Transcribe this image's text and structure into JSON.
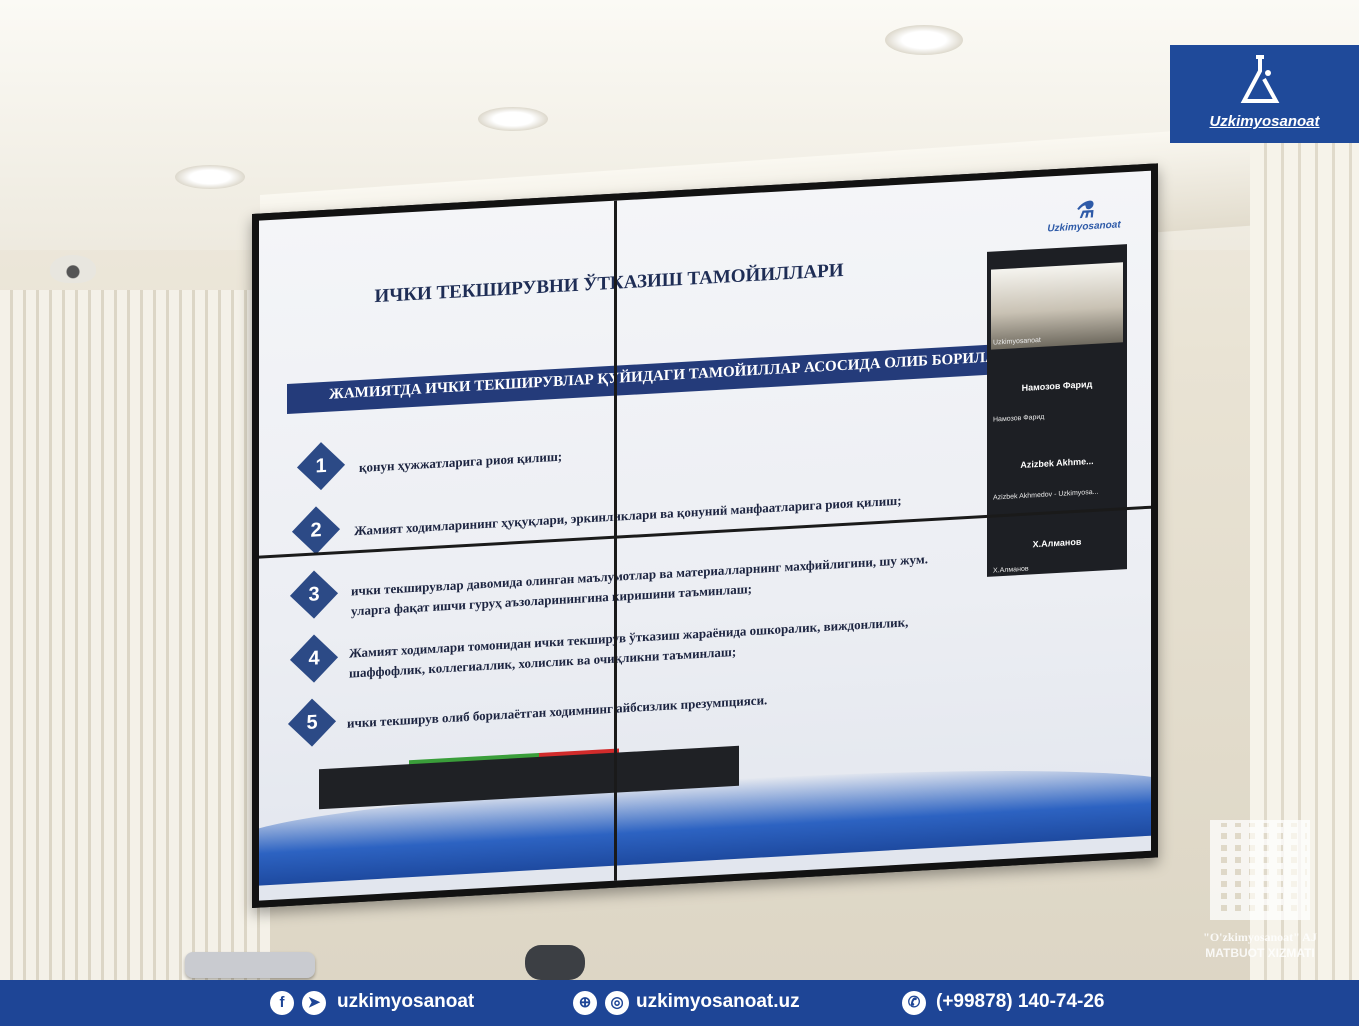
{
  "brand": {
    "name": "Uzkimyosanoat"
  },
  "tv_logo": "Uzkimyosanoat",
  "press_service": {
    "line1": "\"O'zkimyosanoat\" AJ",
    "line2": "MATBUOT XIZMATI"
  },
  "slide": {
    "title": "ИЧКИ ТЕКШИРУВНИ ЎТКАЗИШ ТАМОЙИЛЛАРИ",
    "band": "ЖАМИЯТДА ИЧКИ ТЕКШИРУВЛАР ҚУЙИДАГИ ТАМОЙИЛЛАР АСОСИДА ОЛИБ БОРИЛАД",
    "items": [
      {
        "num": "1",
        "text": "қонун ҳужжатларига риоя қилиш;"
      },
      {
        "num": "2",
        "text": "Жамият ходимларининг ҳуқуқлари, эркинликлари ва қонуний манфаатларига риоя қилиш;"
      },
      {
        "num": "3",
        "text": "ички текширувлар давомида олинган маълумотлар ва материалларнинг махфийлигини, шу жум.",
        "text2": "уларга фақат ишчи гуруҳ аъзоларинингина киришини таъминлаш;"
      },
      {
        "num": "4",
        "text": "Жамият ходимлари томонидан ички текширув ўтказиш жараёнида ошкоралик, виждонлилик,",
        "text2": "шаффофлик, коллегиаллик, холислик ва очиқликни таъминлаш;"
      },
      {
        "num": "5",
        "text": "ички текширув олиб борилаётган ходимнинг айбсизлик презумпцияси."
      }
    ]
  },
  "zoom": {
    "self_caption": "Uzkimyosanoat",
    "participants": [
      {
        "name": "Намозов Фарид",
        "caption": "Намозов Фарид"
      },
      {
        "name": "Azizbek Akhme...",
        "caption": "Azizbek Akhmedov - Uzkimyosa..."
      },
      {
        "name": "Х.Алманов",
        "caption": "Х.Алманов"
      }
    ]
  },
  "footer": {
    "social": "uzkimyosanoat",
    "website": "uzkimyosanoat.uz",
    "phone": "(+99878) 140-74-26"
  },
  "colors": {
    "brand_blue": "#1e4596",
    "slide_band": "#243b7a"
  }
}
